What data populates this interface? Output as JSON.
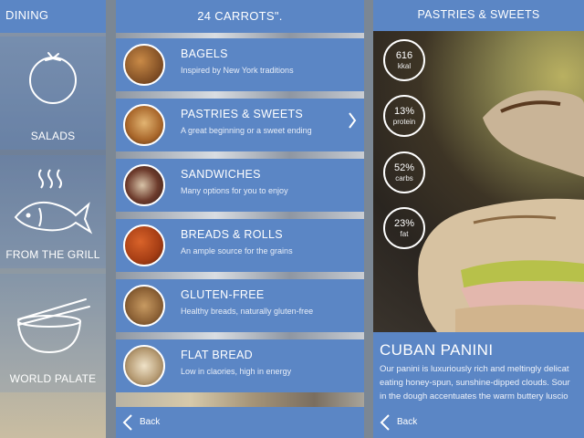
{
  "colors": {
    "accent": "#5b86c5",
    "text": "#ffffff"
  },
  "dining": {
    "title": "DINING",
    "categories": [
      {
        "label": "SALADS",
        "icon": "tomato-icon"
      },
      {
        "label": "FROM THE GRILL",
        "icon": "fish-icon"
      },
      {
        "label": "WORLD PALATE",
        "icon": "bowl-chopsticks-icon"
      }
    ]
  },
  "menu": {
    "title": "24 CARROTS\".",
    "items": [
      {
        "title": "BAGELS",
        "subtitle": "Inspired by New York traditions"
      },
      {
        "title": "PASTRIES & SWEETS",
        "subtitle": "A great beginning or a sweet ending",
        "selected": true
      },
      {
        "title": "SANDWICHES",
        "subtitle": "Many options for you to enjoy"
      },
      {
        "title": "BREADS & ROLLS",
        "subtitle": "An ample source for the grains"
      },
      {
        "title": "GLUTEN-FREE",
        "subtitle": "Healthy breads, naturally gluten-free"
      },
      {
        "title": "FLAT BREAD",
        "subtitle": "Low in claories, high in energy"
      }
    ],
    "back": "Back"
  },
  "detail": {
    "header": "PASTRIES & SWEETS",
    "stats": [
      {
        "value": "616",
        "unit": "kkal"
      },
      {
        "value": "13%",
        "unit": "protein"
      },
      {
        "value": "52%",
        "unit": "carbs"
      },
      {
        "value": "23%",
        "unit": "fat"
      }
    ],
    "title": "CUBAN PANINI",
    "description": [
      "Our panini is luxuriously rich and meltingly delicat",
      "eating honey-spun, sunshine-dipped clouds. Sour",
      "in the dough accentuates the warm buttery luscio"
    ],
    "back": "Back"
  }
}
